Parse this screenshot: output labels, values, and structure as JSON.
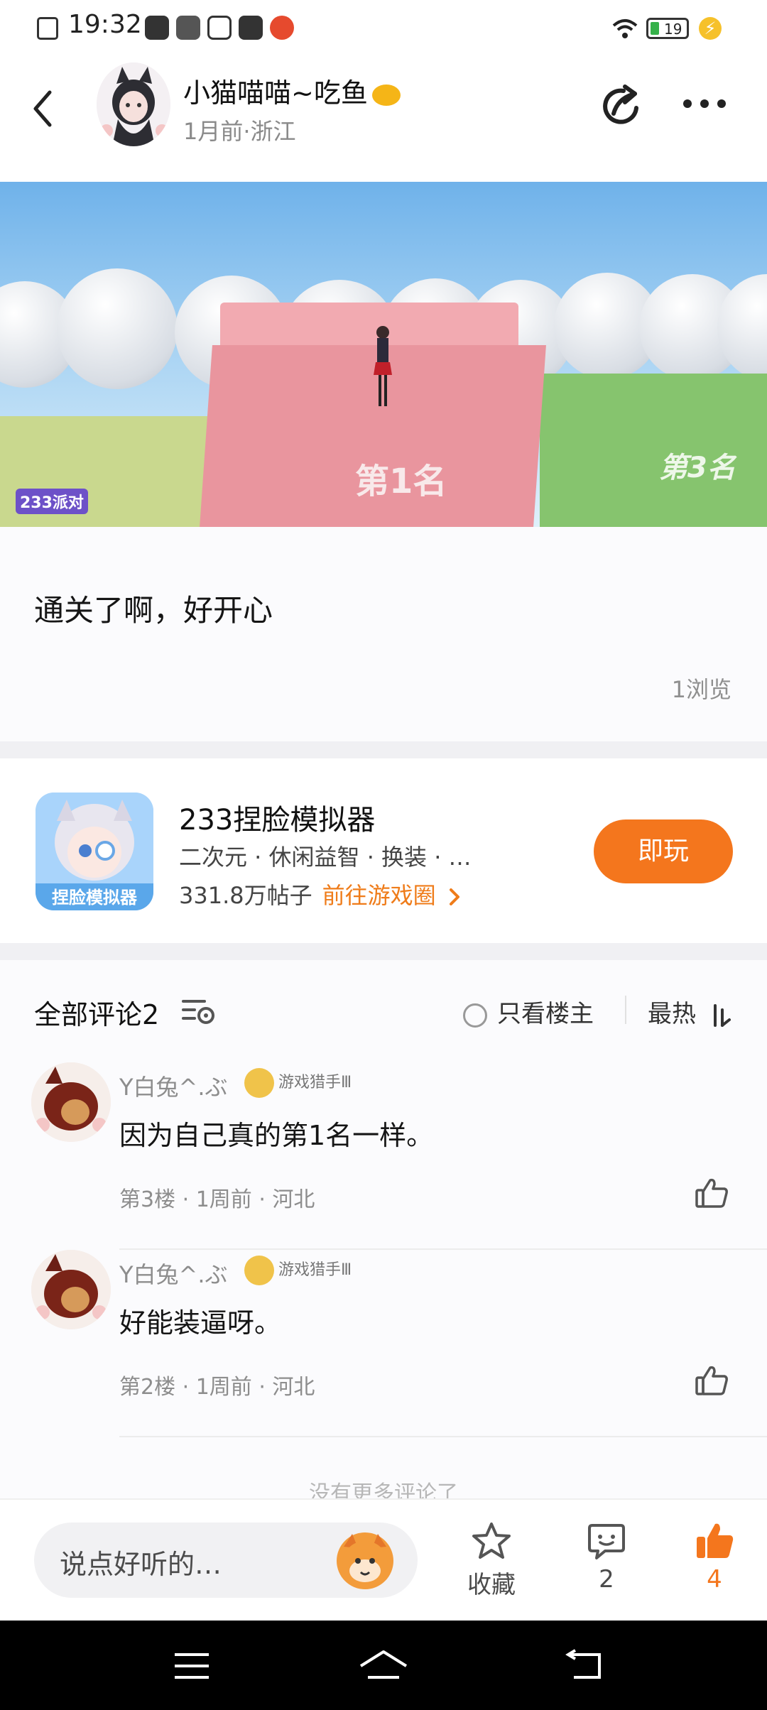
{
  "status_bar": {
    "time": "19:32",
    "battery_level": "19",
    "icons": [
      "sim-card-icon",
      "app-icon",
      "app-icon",
      "app-icon",
      "app-icon",
      "app-icon",
      "wifi-icon",
      "battery-icon",
      "charging-icon"
    ]
  },
  "header": {
    "username": "小猫喵喵~吃鱼",
    "meta": "1月前·浙江",
    "icons": [
      "back-arrow-icon",
      "share-icon",
      "more-icon"
    ]
  },
  "banner": {
    "label_first": "第1名",
    "label_third": "第3名",
    "logo": "233派对"
  },
  "post": {
    "text": "通关了啊，好开心",
    "views": "1浏览"
  },
  "game_card": {
    "title": "233捏脸模拟器",
    "tags": "二次元 · 休闲益智 · 换装 · …",
    "post_count": "331.8万帖子",
    "link_label": "前往游戏圈",
    "link_icon": "chevron-right-icon",
    "play_label": "即玩",
    "accent_color": "#f4761d"
  },
  "comments": {
    "header_title": "全部评论2",
    "only_owner_label": "只看楼主",
    "sort_label": "最热",
    "items": [
      {
        "user": "Y白兔^.ぶ",
        "badge": "游戏猎手Ⅲ",
        "text": "因为自己真的第1名一样。",
        "meta": "第3楼 · 1周前 · 河北"
      },
      {
        "user": "Y白兔^.ぶ",
        "badge": "游戏猎手Ⅲ",
        "text": "好能装逼呀。",
        "meta": "第2楼 · 1周前 · 河北"
      }
    ],
    "no_more": "没有更多评论了"
  },
  "action_bar": {
    "placeholder": "说点好听的…",
    "favorite_label": "收藏",
    "comment_count": "2",
    "like_count": "4",
    "like_color": "#f4761d"
  },
  "nav_bar": {
    "icons": [
      "menu-icon",
      "home-icon",
      "back-icon"
    ]
  }
}
